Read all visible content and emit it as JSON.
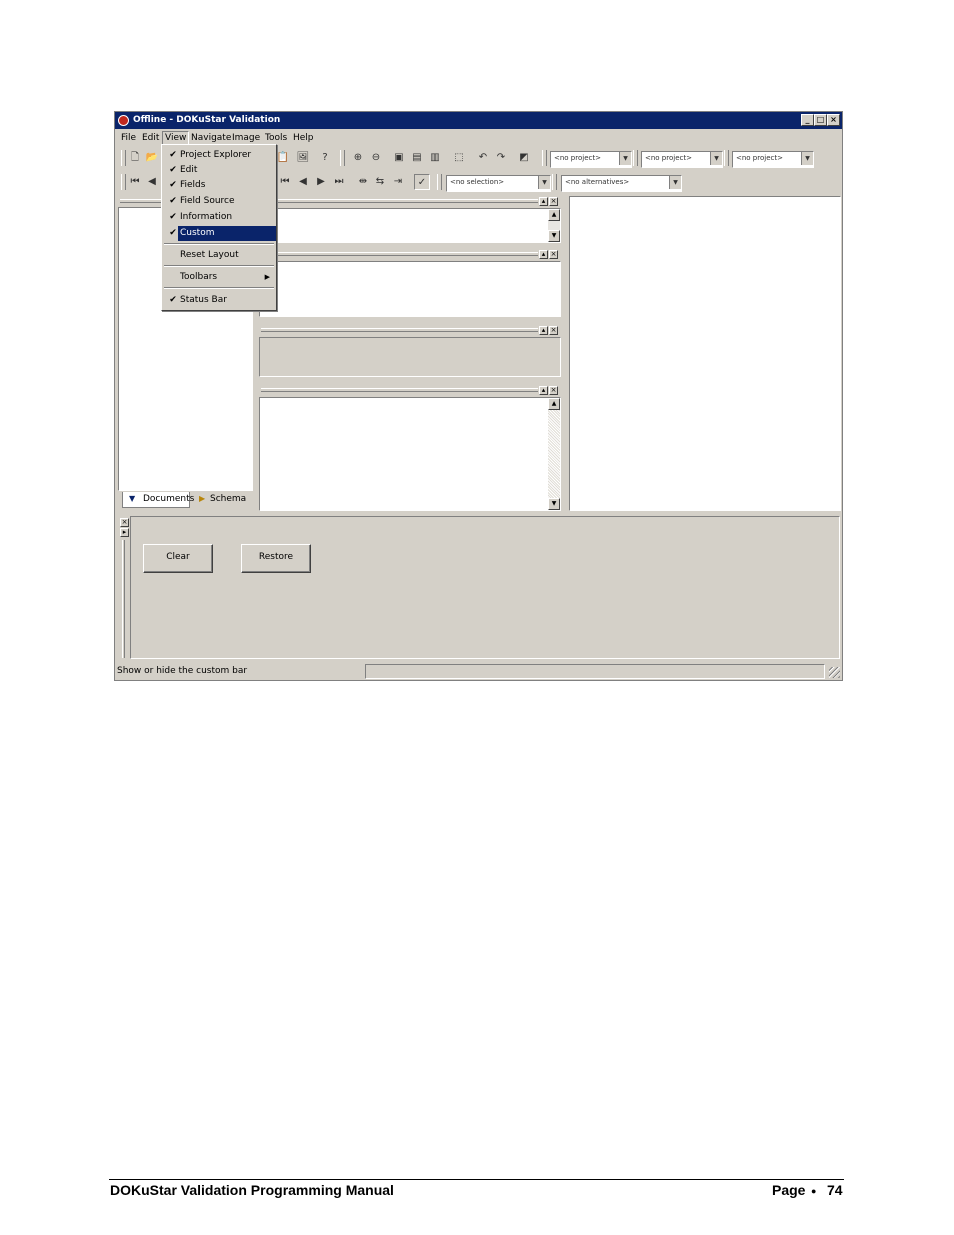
{
  "window": {
    "title": "Offline - DOKuStar Validation",
    "caption_min": "_",
    "caption_max": "□",
    "caption_close": "×"
  },
  "menubar": [
    "File",
    "Edit",
    "View",
    "Navigate",
    "Image",
    "Tools",
    "Help"
  ],
  "view_menu": {
    "items": [
      {
        "label": "Project Explorer",
        "checked": true
      },
      {
        "label": "Edit",
        "checked": true
      },
      {
        "label": "Fields",
        "checked": true
      },
      {
        "label": "Field Source",
        "checked": true
      },
      {
        "label": "Information",
        "checked": true
      },
      {
        "label": "Custom",
        "checked": true,
        "highlighted": true
      },
      {
        "label": "Reset Layout",
        "checked": false
      },
      {
        "label": "Toolbars",
        "checked": false,
        "submenu": true
      },
      {
        "label": "Status Bar",
        "checked": true
      }
    ],
    "check_glyph": "✔",
    "submenu_glyph": "▶"
  },
  "toolbar": {
    "project_combo_1": "<no project>",
    "project_combo_2": "<no project>",
    "project_combo_3": "<no project>",
    "selection_combo": "<no selection>",
    "alternatives_combo": "<no alternatives>"
  },
  "explorer": {
    "tab_documents": "Documents",
    "tab_schema": "Schema"
  },
  "custom_bar": {
    "clear_label": "Clear",
    "restore_label": "Restore"
  },
  "statusbar": {
    "text": "Show or hide the custom bar"
  },
  "footer": {
    "title": "DOKuStar Validation Programming Manual",
    "page_label": "Page",
    "bullet": "●",
    "page_number": "74"
  }
}
